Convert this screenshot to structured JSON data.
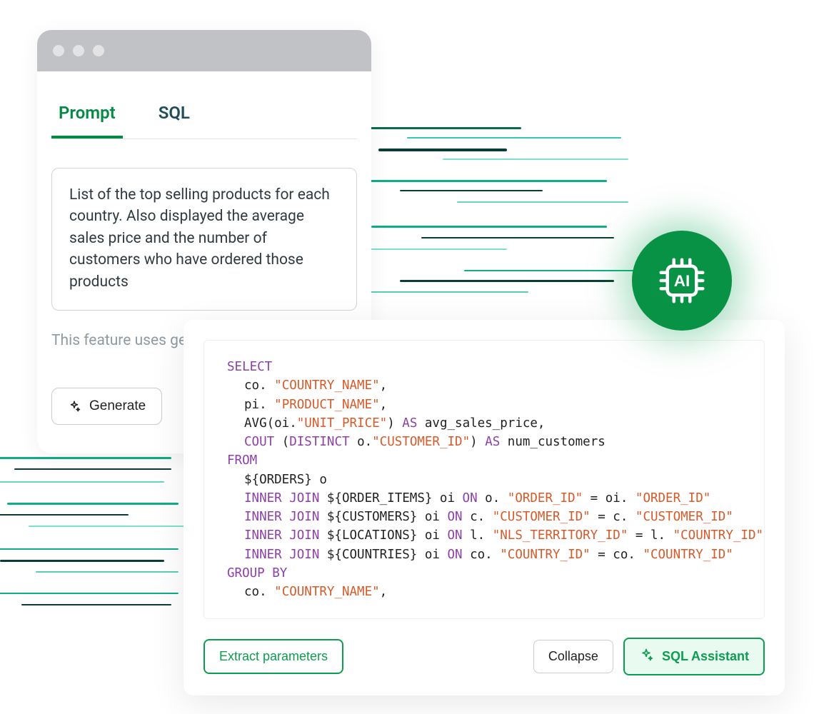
{
  "tabs": {
    "prompt": "Prompt",
    "sql": "SQL"
  },
  "prompt_text": "List of the top selling products for each country. Also displayed the average sales price and the number of customers who have ordered those products",
  "feature_note": "This feature uses gen",
  "generate_label": "Generate",
  "sql": {
    "select": "SELECT",
    "line_country": "co. \"COUNTRY_NAME\",",
    "line_product": "pi. \"PRODUCT_NAME\",",
    "line_avg_pre": "AVG(oi.",
    "line_avg_str": "\"UNIT_PRICE\"",
    "line_avg_mid": ") ",
    "line_avg_as": "AS",
    "line_avg_tail": " avg_sales_price,",
    "line_cout": "COUT",
    "line_cout_open": " (",
    "line_distinct": "DISTINCT",
    "line_cout_mid": " o.",
    "line_custid": "\"CUSTOMER_ID\"",
    "line_cout_close": ") ",
    "line_cout_as": "AS",
    "line_cout_tail": " num_customers",
    "from": "FROM",
    "orders": "${ORDERS} o",
    "inner_join": "INNER JOIN",
    "on": "ON",
    "j1_tbl": " ${ORDER_ITEMS} oi ",
    "j1_l": " o. ",
    "j1_str1": "\"ORDER_ID\"",
    "j1_eq": " = oi. ",
    "j1_str2": "\"ORDER_ID\"",
    "j2_tbl": " ${CUSTOMERS} oi ",
    "j2_l": " c. ",
    "j2_str1": "\"CUSTOMER_ID\"",
    "j2_eq": " = c. ",
    "j2_str2": "\"CUSTOMER_ID\"",
    "j3_tbl": " ${LOCATIONS} oi ",
    "j3_l": " l. ",
    "j3_str1": "\"NLS_TERRITORY_ID\"",
    "j3_eq": " = l. ",
    "j3_str2": "\"COUNTRY_ID\"",
    "j4_tbl": " ${COUNTRIES} oi ",
    "j4_l": " co. ",
    "j4_str1": "\"COUNTRY_ID\"",
    "j4_eq": " = co. ",
    "j4_str2": "\"COUNTRY_ID\"",
    "group_by": "GROUP BY",
    "gb_line": "co. \"COUNTRY_NAME\","
  },
  "buttons": {
    "extract": "Extract parameters",
    "collapse": "Collapse",
    "assistant": "SQL Assistant"
  }
}
